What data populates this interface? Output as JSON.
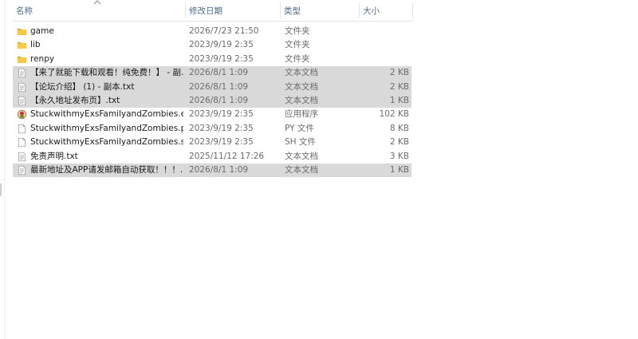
{
  "columns": {
    "name": "名称",
    "date": "修改日期",
    "type": "类型",
    "size": "大小"
  },
  "files": [
    {
      "name": "game",
      "date": "2026/7/23 21:50",
      "type": "文件夹",
      "size": "",
      "icon": "folder-icon",
      "selected": false
    },
    {
      "name": "lib",
      "date": "2023/9/19 2:35",
      "type": "文件夹",
      "size": "",
      "icon": "folder-icon",
      "selected": false
    },
    {
      "name": "renpy",
      "date": "2023/9/19 2:35",
      "type": "文件夹",
      "size": "",
      "icon": "folder-icon",
      "selected": false
    },
    {
      "name": "【来了就能下载和观看！纯免费！】 - 副...",
      "date": "2026/8/1 1:09",
      "type": "文本文档",
      "size": "2 KB",
      "icon": "text-file-icon",
      "selected": true
    },
    {
      "name": "【论坛介绍】 (1) - 副本.txt",
      "date": "2026/8/1 1:09",
      "type": "文本文档",
      "size": "2 KB",
      "icon": "text-file-icon",
      "selected": true
    },
    {
      "name": "【永久地址发布页】.txt",
      "date": "2026/8/1 1:09",
      "type": "文本文档",
      "size": "1 KB",
      "icon": "text-file-icon",
      "selected": true
    },
    {
      "name": "StuckwithmyExsFamilyandZombies.exe",
      "date": "2023/9/19 2:35",
      "type": "应用程序",
      "size": "102 KB",
      "icon": "app-icon",
      "selected": false
    },
    {
      "name": "StuckwithmyExsFamilyandZombies.py",
      "date": "2023/9/19 2:35",
      "type": "PY 文件",
      "size": "8 KB",
      "icon": "blank-file-icon",
      "selected": false
    },
    {
      "name": "StuckwithmyExsFamilyandZombies.sh",
      "date": "2023/9/19 2:35",
      "type": "SH 文件",
      "size": "2 KB",
      "icon": "blank-file-icon",
      "selected": false
    },
    {
      "name": "免责声明.txt",
      "date": "2025/11/12 17:26",
      "type": "文本文档",
      "size": "3 KB",
      "icon": "text-file-icon",
      "selected": false
    },
    {
      "name": "最新地址及APP请发邮箱自动获取！！！...",
      "date": "2026/8/1 1:09",
      "type": "文本文档",
      "size": "1 KB",
      "icon": "text-file-icon",
      "selected": true
    }
  ],
  "colors": {
    "header_text": "#4d6a8a",
    "selection": "#d9d9d9",
    "folder": "#f7c948",
    "folder_dark": "#e0a92a"
  }
}
